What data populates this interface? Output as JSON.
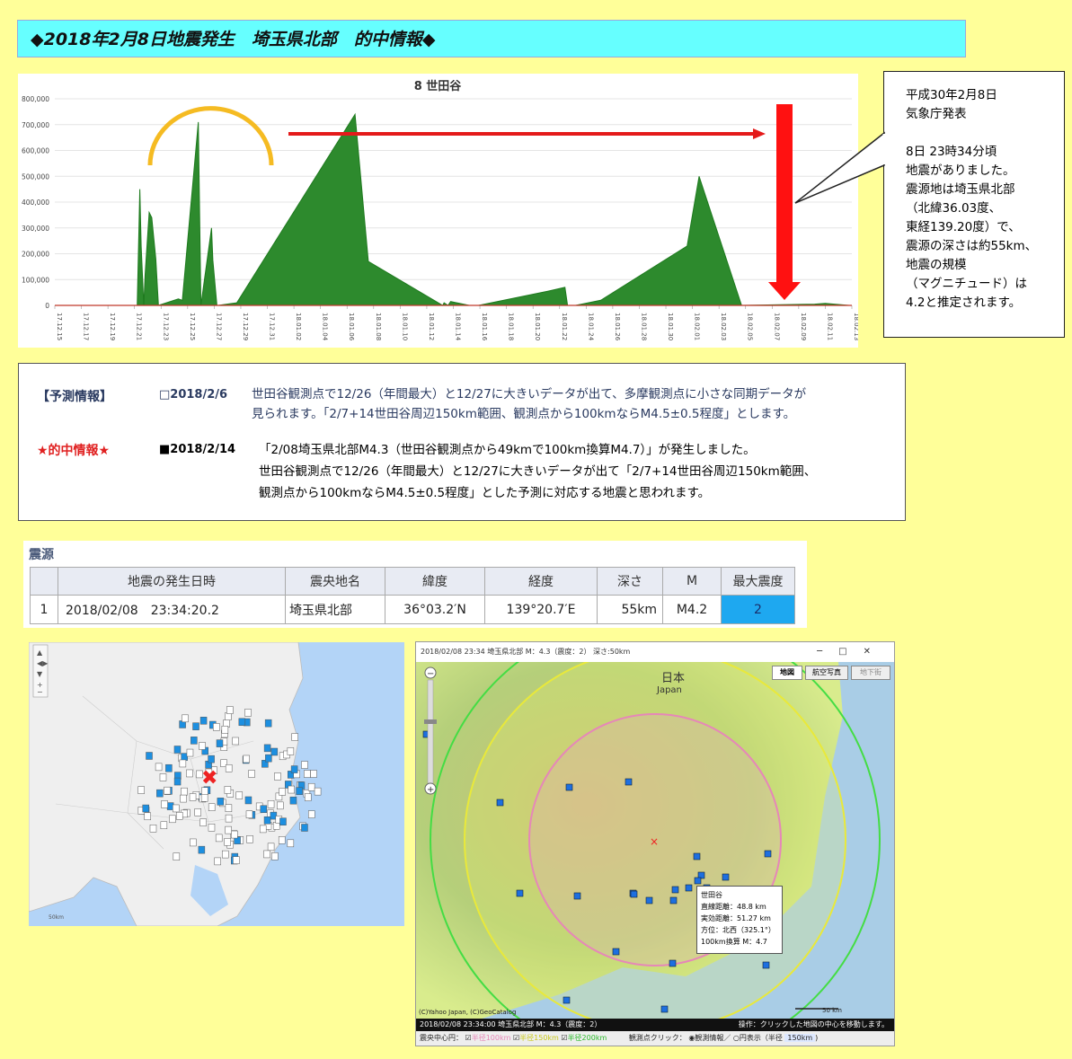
{
  "title": "◆2018年2月8日地震発生　埼玉県北部　的中情報◆",
  "chart_data": {
    "type": "area",
    "title": "8 世田谷",
    "ylim": [
      0,
      800000
    ],
    "y_ticks": [
      "800,000",
      "700,000",
      "600,000",
      "500,000",
      "400,000",
      "300,000",
      "200,000",
      "100,000",
      "0"
    ],
    "x_ticks": [
      "17.12.15",
      "17.12.17",
      "17.12.19",
      "17.12.21",
      "17.12.23",
      "17.12.25",
      "17.12.27",
      "17.12.29",
      "17.12.31",
      "18.01.02",
      "18.01.04",
      "18.01.06",
      "18.01.08",
      "18.01.10",
      "18.01.12",
      "18.01.14",
      "18.01.16",
      "18.01.18",
      "18.01.20",
      "18.01.22",
      "18.01.24",
      "18.01.26",
      "18.01.28",
      "18.01.30",
      "18.02.01",
      "18.02.03",
      "18.02.05",
      "18.02.07",
      "18.02.09",
      "18.02.11",
      "18.02.13"
    ],
    "x_range": [
      0,
      30
    ],
    "x": [
      6.2,
      6.4,
      6.5,
      6.7,
      6.8,
      7.1,
      7.3,
      7.6,
      7.8,
      9.3,
      9.6,
      10.8,
      11.0,
      11.8,
      11.9,
      12.2,
      12.3,
      13.7,
      22.6,
      23.6,
      29.2,
      29.3,
      29.6,
      29.8,
      31.2,
      31.9,
      37.1,
      38.4,
      38.6,
      39.1,
      39.2,
      41.1,
      47.6,
      48.5,
      51.7,
      57.2,
      58.0,
      59.8
    ],
    "values": [
      0,
      450000,
      230000,
      0,
      120000,
      360000,
      340000,
      180000,
      0,
      25000,
      20000,
      710000,
      0,
      300000,
      175000,
      0,
      0,
      10000,
      740000,
      170000,
      0,
      10000,
      0,
      15000,
      0,
      0,
      55000,
      70000,
      0,
      0,
      0,
      20000,
      230000,
      500000,
      0,
      5000,
      8000,
      0
    ],
    "annotations": []
  },
  "callout_text": "平成30年2月8日\n気象庁発表\n\n8日 23時34分頃\n地震がありました。\n震源地は埼玉県北部\n（北緯36.03度、\n東経139.20度）で、\n震源の深さは約55km、\n地震の規模\n（マグニチュード）は\n4.2と推定されます。",
  "forecast": {
    "label": "【予測情報】",
    "date": "□2018/2/6",
    "text": "世田谷観測点で12/26（年間最大）と12/27に大きいデータが出て、多摩観測点に小さな同期データが\n見られます。「2/7+14世田谷周辺150km範囲、観測点から100kmならM4.5±0.5程度」とします。"
  },
  "hit": {
    "label": "★的中情報★",
    "date": "■2018/2/14",
    "text": "「2/08埼玉県北部M4.3（世田谷観測点から49kmで100km換算M4.7）」が発生しました。\n世田谷観測点で12/26（年間最大）と12/27に大きいデータが出て「2/7+14世田谷周辺150km範囲、\n観測点から100kmならM4.5±0.5程度」とした予測に対応する地震と思われます。"
  },
  "quake_table": {
    "section_title": "震源",
    "headers": [
      "",
      "地震の発生日時",
      "震央地名",
      "緯度",
      "経度",
      "深さ",
      "M",
      "最大震度"
    ],
    "row": [
      "1",
      "2018/02/08　23:34:20.2",
      "埼玉県北部",
      "36°03.2′N",
      "139°20.7′E",
      "55km",
      "M4.2",
      "2"
    ],
    "max_intensity_color": "#1ea8f0"
  },
  "map_left": {
    "scale_label": "50km"
  },
  "map_right": {
    "window_title": "2018/02/08 23:34 埼玉県北部 M：4.3（震度：2） 深さ:50km",
    "btn_map": "地図",
    "btn_aerial": "航空写真",
    "btn_terrain": "地下街",
    "label_japan": "日本\nJapan",
    "tooltip": "世田谷\n直線距離：48.8 km\n実効距離：51.27 km\n方位：北西（325.1°）\n100km換算 M：4.7",
    "status_left": "2018/02/08 23:34:00 埼玉県北部 M：4.3（震度：2）",
    "status_right": "操作：クリックした地図の中心を移動します。",
    "copyright": "(C)Yahoo Japan, (C)GeoCatalog",
    "scale": "50 km",
    "footer_center": "震央中心円：",
    "footer_r100": "半径100km",
    "footer_r150": "半径150km",
    "footer_r200": "半径200km",
    "footer_click": "観測点クリック：",
    "footer_opt1": "観測情報／",
    "footer_opt2": "円表示（半径",
    "footer_radius": "150km",
    "footer_close": ")"
  }
}
